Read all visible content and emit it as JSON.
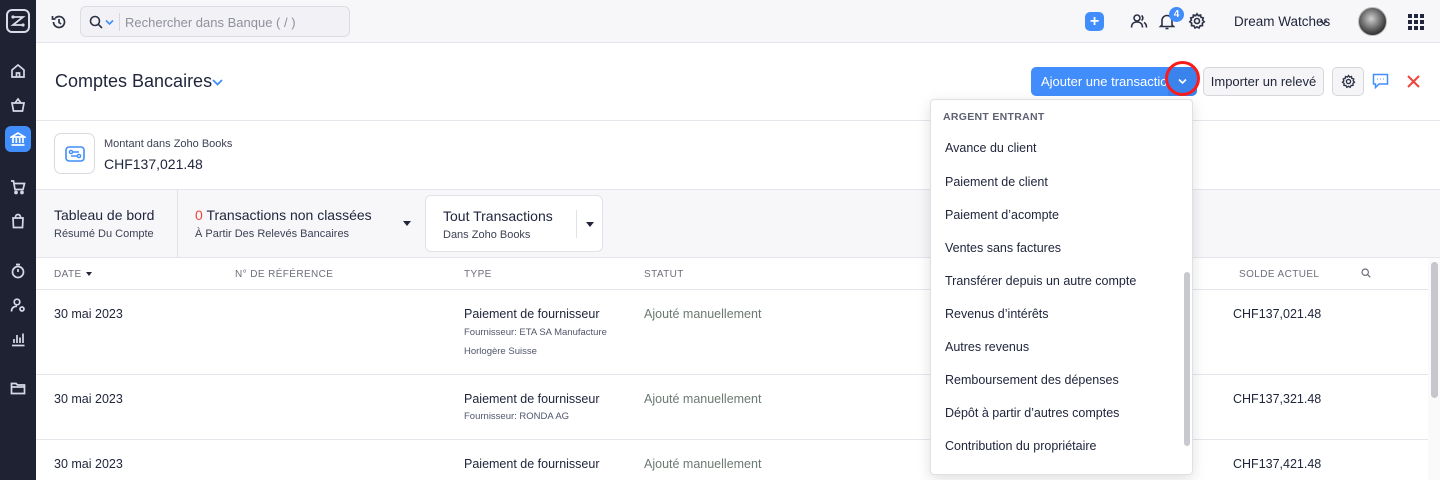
{
  "search": {
    "placeholder": "Rechercher dans Banque ( / )"
  },
  "topbar": {
    "notification_count": "4",
    "org_name": "Dream Watches"
  },
  "page": {
    "title": "Comptes Bancaires"
  },
  "actions": {
    "add_transaction": "Ajouter une transaction",
    "import_statement": "Importer un relevé"
  },
  "account": {
    "amount_label": "Montant dans Zoho Books",
    "amount_value": "CHF137,021.48"
  },
  "tabs": {
    "dashboard": {
      "title": "Tableau de bord",
      "subtitle": "Résumé Du Compte"
    },
    "uncategorized": {
      "count": "0",
      "title": "Transactions non classées",
      "subtitle": "À Partir Des Relevés Bancaires"
    },
    "all": {
      "title": "Tout Transactions",
      "subtitle": "Dans Zoho Books"
    }
  },
  "table": {
    "headers": {
      "date": "DATE",
      "reference": "N° DE RÉFÉRENCE",
      "type": "TYPE",
      "status": "STATUT",
      "balance": "SOLDE ACTUEL"
    },
    "rows": [
      {
        "date": "30 mai 2023",
        "type": "Paiement de fournisseur",
        "vendor_line1": "Fournisseur: ETA SA Manufacture",
        "vendor_line2": "Horlogère Suisse",
        "status": "Ajouté manuellement",
        "balance": "CHF137,021.48"
      },
      {
        "date": "30 mai 2023",
        "type": "Paiement de fournisseur",
        "vendor_line1": "Fournisseur: RONDA AG",
        "status": "Ajouté manuellement",
        "balance": "CHF137,321.48"
      },
      {
        "date": "30 mai 2023",
        "type": "Paiement de fournisseur",
        "status": "Ajouté manuellement",
        "balance": "CHF137,421.48"
      }
    ]
  },
  "dropdown": {
    "heading": "ARGENT ENTRANT",
    "items": [
      "Avance du client",
      "Paiement de client",
      "Paiement d’acompte",
      "Ventes sans factures",
      "Transférer depuis un autre compte",
      "Revenus d’intérêts",
      "Autres revenus",
      "Remboursement des dépenses",
      "Dépôt à partir d’autres comptes",
      "Contribution du propriétaire"
    ]
  },
  "colors": {
    "accent": "#408dfb",
    "sidebar": "#1f2233",
    "danger": "#f0443b",
    "highlight": "#ff1a1a"
  }
}
